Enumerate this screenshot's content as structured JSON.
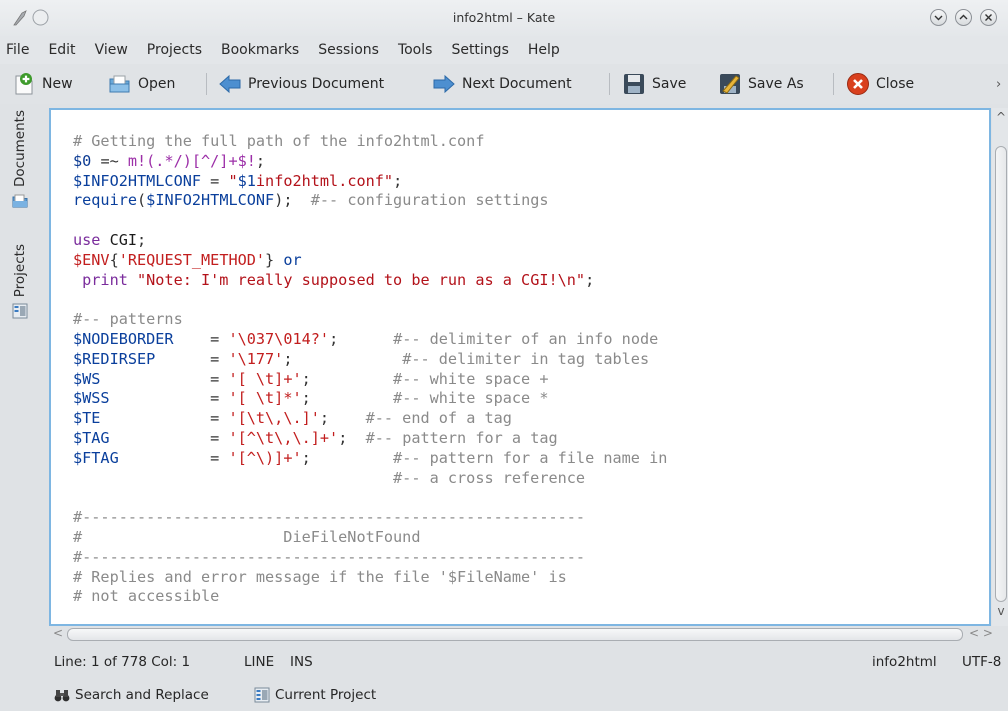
{
  "window": {
    "title": "info2html – Kate"
  },
  "menubar": {
    "items": [
      "File",
      "Edit",
      "View",
      "Projects",
      "Bookmarks",
      "Sessions",
      "Tools",
      "Settings",
      "Help"
    ]
  },
  "toolbar": {
    "new_label": "New",
    "open_label": "Open",
    "previous_label": "Previous Document",
    "next_label": "Next Document",
    "save_label": "Save",
    "save_as_label": "Save As",
    "close_label": "Close",
    "overflow_label": "›"
  },
  "sidebar": {
    "tabs": [
      {
        "label": "Documents",
        "icon": "documents-icon"
      },
      {
        "label": "Projects",
        "icon": "projects-icon"
      }
    ]
  },
  "editor": {
    "lines": [
      [
        {
          "t": "# Getting the full path of the info2html.conf",
          "c": "cm"
        }
      ],
      [
        {
          "t": "$0",
          "c": "vrb"
        },
        {
          "t": " =~ ",
          "c": "op"
        },
        {
          "t": "m!(.*/)[^/]+$!",
          "c": "rx"
        },
        {
          "t": ";",
          "c": "op"
        }
      ],
      [
        {
          "t": "$INFO2HTMLCONF",
          "c": "vr"
        },
        {
          "t": " = ",
          "c": "op"
        },
        {
          "t": "\"",
          "c": "dq"
        },
        {
          "t": "$1",
          "c": "vr"
        },
        {
          "t": "info2html.conf",
          "c": "dq"
        },
        {
          "t": "\"",
          "c": "dq"
        },
        {
          "t": ";",
          "c": "op"
        }
      ],
      [
        {
          "t": "require",
          "c": "vr"
        },
        {
          "t": "(",
          "c": "op"
        },
        {
          "t": "$INFO2HTMLCONF",
          "c": "vr"
        },
        {
          "t": ");  ",
          "c": "op"
        },
        {
          "t": "#-- configuration settings",
          "c": "cm"
        }
      ],
      [
        {
          "t": "",
          "c": "op"
        }
      ],
      [
        {
          "t": "use ",
          "c": "fn"
        },
        {
          "t": "CGI",
          "c": "id"
        },
        {
          "t": ";",
          "c": "op"
        }
      ],
      [
        {
          "t": "$ENV",
          "c": "st"
        },
        {
          "t": "{",
          "c": "op"
        },
        {
          "t": "'REQUEST_METHOD'",
          "c": "st"
        },
        {
          "t": "} ",
          "c": "op"
        },
        {
          "t": "or",
          "c": "vr"
        }
      ],
      [
        {
          "t": " print ",
          "c": "fn"
        },
        {
          "t": "\"Note: I'm really supposed to be run as a CGI!\\n\"",
          "c": "dq"
        },
        {
          "t": ";",
          "c": "op"
        }
      ],
      [
        {
          "t": "",
          "c": "op"
        }
      ],
      [
        {
          "t": "#-- patterns",
          "c": "cm"
        }
      ],
      [
        {
          "t": "$NODEBORDER",
          "c": "vr"
        },
        {
          "t": "    = ",
          "c": "op"
        },
        {
          "t": "'\\037\\014?'",
          "c": "st"
        },
        {
          "t": ";      ",
          "c": "op"
        },
        {
          "t": "#-- delimiter of an info node",
          "c": "cm"
        }
      ],
      [
        {
          "t": "$REDIRSEP",
          "c": "vr"
        },
        {
          "t": "      = ",
          "c": "op"
        },
        {
          "t": "'\\177'",
          "c": "st"
        },
        {
          "t": ";            ",
          "c": "op"
        },
        {
          "t": "#-- delimiter in tag tables",
          "c": "cm"
        }
      ],
      [
        {
          "t": "$WS",
          "c": "vr"
        },
        {
          "t": "            = ",
          "c": "op"
        },
        {
          "t": "'[ \\t]+'",
          "c": "st"
        },
        {
          "t": ";         ",
          "c": "op"
        },
        {
          "t": "#-- white space +",
          "c": "cm"
        }
      ],
      [
        {
          "t": "$WSS",
          "c": "vr"
        },
        {
          "t": "           = ",
          "c": "op"
        },
        {
          "t": "'[ \\t]*'",
          "c": "st"
        },
        {
          "t": ";         ",
          "c": "op"
        },
        {
          "t": "#-- white space *",
          "c": "cm"
        }
      ],
      [
        {
          "t": "$TE",
          "c": "vr"
        },
        {
          "t": "            = ",
          "c": "op"
        },
        {
          "t": "'[\\t\\,\\.]'",
          "c": "st"
        },
        {
          "t": ";    ",
          "c": "op"
        },
        {
          "t": "#-- end of a tag",
          "c": "cm"
        }
      ],
      [
        {
          "t": "$TAG",
          "c": "vr"
        },
        {
          "t": "           = ",
          "c": "op"
        },
        {
          "t": "'[^\\t\\,\\.]+'",
          "c": "st"
        },
        {
          "t": ";  ",
          "c": "op"
        },
        {
          "t": "#-- pattern for a tag",
          "c": "cm"
        }
      ],
      [
        {
          "t": "$FTAG",
          "c": "vr"
        },
        {
          "t": "          = ",
          "c": "op"
        },
        {
          "t": "'[^\\)]+'",
          "c": "st"
        },
        {
          "t": ";         ",
          "c": "op"
        },
        {
          "t": "#-- pattern for a file name in",
          "c": "cm"
        }
      ],
      [
        {
          "t": "                                   ",
          "c": "op"
        },
        {
          "t": "#-- a cross reference",
          "c": "cm"
        }
      ],
      [
        {
          "t": "",
          "c": "op"
        }
      ],
      [
        {
          "t": "#-------------------------------------------------------",
          "c": "cm"
        }
      ],
      [
        {
          "t": "#                      DieFileNotFound",
          "c": "cm"
        }
      ],
      [
        {
          "t": "#-------------------------------------------------------",
          "c": "cm"
        }
      ],
      [
        {
          "t": "# Replies and error message if the file '$FileName' is",
          "c": "cm"
        }
      ],
      [
        {
          "t": "# not accessible",
          "c": "cm"
        }
      ]
    ]
  },
  "statusbar": {
    "position": "Line: 1 of 778 Col: 1",
    "mode": "LINE",
    "insert": "INS",
    "filetype": "info2html",
    "encoding": "UTF-8"
  },
  "bottombar": {
    "search_label": "Search and Replace",
    "project_label": "Current Project"
  },
  "colors": {
    "accent_border": "#7eb6e2",
    "comment": "#8a8a8a",
    "variable": "#0a3f9c",
    "string": "#c21e1e"
  }
}
